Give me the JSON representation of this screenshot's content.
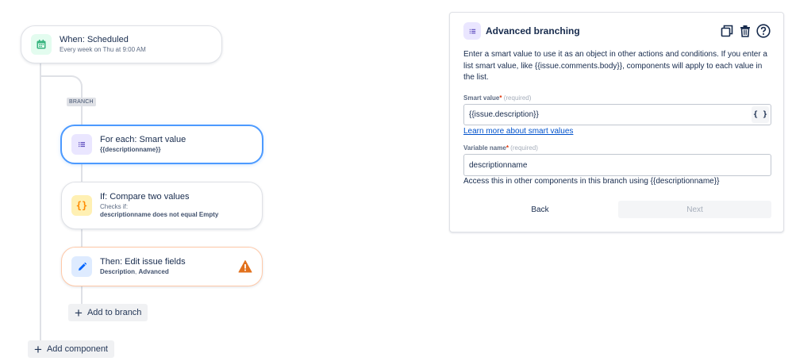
{
  "flow": {
    "trigger": {
      "title": "When: Scheduled",
      "subtitle": "Every week on Thu at 9:00 AM"
    },
    "branch_tag": "BRANCH",
    "for_each": {
      "title": "For each: Smart value",
      "subtitle": "{{descriptionname}}"
    },
    "condition": {
      "title": "If: Compare two values",
      "subtitle": "Checks if:",
      "detail": "descriptionname does not equal Empty"
    },
    "action": {
      "title": "Then: Edit issue fields",
      "detail_bold": "Description",
      "detail_sep": ", ",
      "detail_rest": "Advanced"
    },
    "add_to_branch": "Add to branch",
    "add_component": "Add component"
  },
  "panel": {
    "title": "Advanced branching",
    "description": "Enter a smart value to use it as an object in other actions and conditions. If you enter a list smart value, like {{issue.comments.body}}, components will apply to each value in the list.",
    "smart_value_label": "Smart value",
    "variable_name_label": "Variable name",
    "required_marker": "*",
    "required_hint": "(required)",
    "smart_value": "{{issue.description}}",
    "smart_value_button": "{ }",
    "learn_more": "Learn more about smart values",
    "variable_name": "descriptionname",
    "access_text": "Access this in other components in this branch using {{descriptionname}}",
    "back": "Back",
    "next": "Next"
  },
  "icons": {
    "trigger": "calendar-icon",
    "for_each": "list-icon",
    "condition": "braces-icon",
    "action": "pencil-icon",
    "warning": "warning-icon",
    "panel_title": "list-icon",
    "duplicate": "duplicate-icon",
    "delete": "trash-icon",
    "help": "help-icon"
  },
  "colors": {
    "selected_border": "#4c9aff",
    "link": "#0052cc",
    "warning": "#e2711d"
  }
}
